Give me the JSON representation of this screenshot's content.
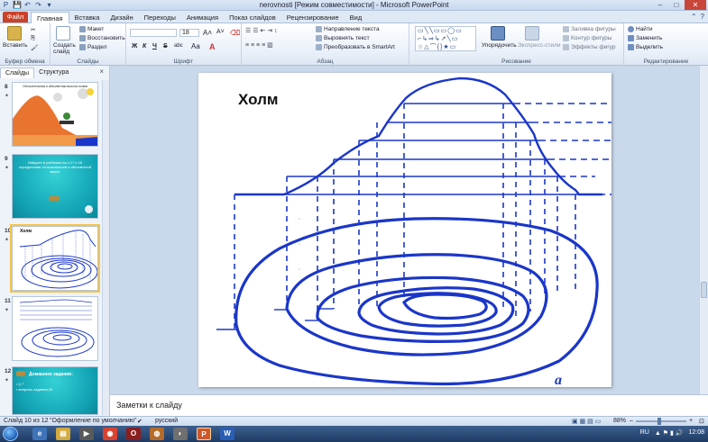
{
  "window": {
    "title": "nerovnosti [Режим совместимости] - Microsoft PowerPoint",
    "controls": [
      "–",
      "□",
      "✕"
    ],
    "quick_access": [
      "P",
      "💾",
      "↶",
      "↷",
      "▾"
    ]
  },
  "tabs": {
    "file": "Файл",
    "items": [
      "Главная",
      "Вставка",
      "Дизайн",
      "Переходы",
      "Анимация",
      "Показ слайдов",
      "Рецензирование",
      "Вид"
    ],
    "active": "Главная"
  },
  "ribbon": {
    "clipboard": {
      "paste": "Вставить",
      "label": "Буфер обмена"
    },
    "slides": {
      "new_slide": "Создать слайд",
      "layout": "Макет",
      "reset": "Восстановить",
      "section": "Раздел",
      "label": "Слайды"
    },
    "font": {
      "size": "18",
      "label": "Шрифт",
      "bold": "Ж",
      "italic": "К",
      "underline": "Ч",
      "strike": "S",
      "abc": "abc"
    },
    "paragraph": {
      "text_direction": "Направление текста",
      "align_text": "Выровнять текст",
      "smartart": "Преобразовать в SmartArt",
      "label": "Абзац"
    },
    "drawing": {
      "arrange": "Упорядочить",
      "quick_styles": "Экспресс-стили",
      "fill": "Заливка фигуры",
      "outline": "Контур фигуры",
      "effects": "Эффекты фигур",
      "label": "Рисование"
    },
    "editing": {
      "find": "Найти",
      "replace": "Заменить",
      "select": "Выделить",
      "label": "Редактирование"
    }
  },
  "pane": {
    "tabs": [
      "Слайды",
      "Структура"
    ],
    "close": "×",
    "thumbnails": [
      {
        "num": "8",
        "text": "Относительная и абсолютная высота холма"
      },
      {
        "num": "9",
        "text": "Найдите в учебнике на с.17 и 18 определение относительной и абсолютной высот"
      },
      {
        "num": "10",
        "text": "Холм"
      },
      {
        "num": "11",
        "text": ""
      },
      {
        "num": "12",
        "text": "Домашнее задание:"
      }
    ],
    "thumb12_lines": [
      "• § 7",
      "• вопросы задания,16"
    ]
  },
  "slide": {
    "title": "Холм",
    "corner_letter": "а"
  },
  "notes": {
    "placeholder": "Заметки к слайду"
  },
  "status": {
    "slide_info": "Слайд 10 из 12",
    "theme": "\"Оформление по умолчанию\"",
    "language": "русский",
    "zoom": "88%"
  },
  "taskbar": {
    "lang": "RU",
    "time": "12:08"
  },
  "colors": {
    "accent": "#1a36c9",
    "file_tab": "#c9422a",
    "selected_thumb": "#f4c546"
  }
}
